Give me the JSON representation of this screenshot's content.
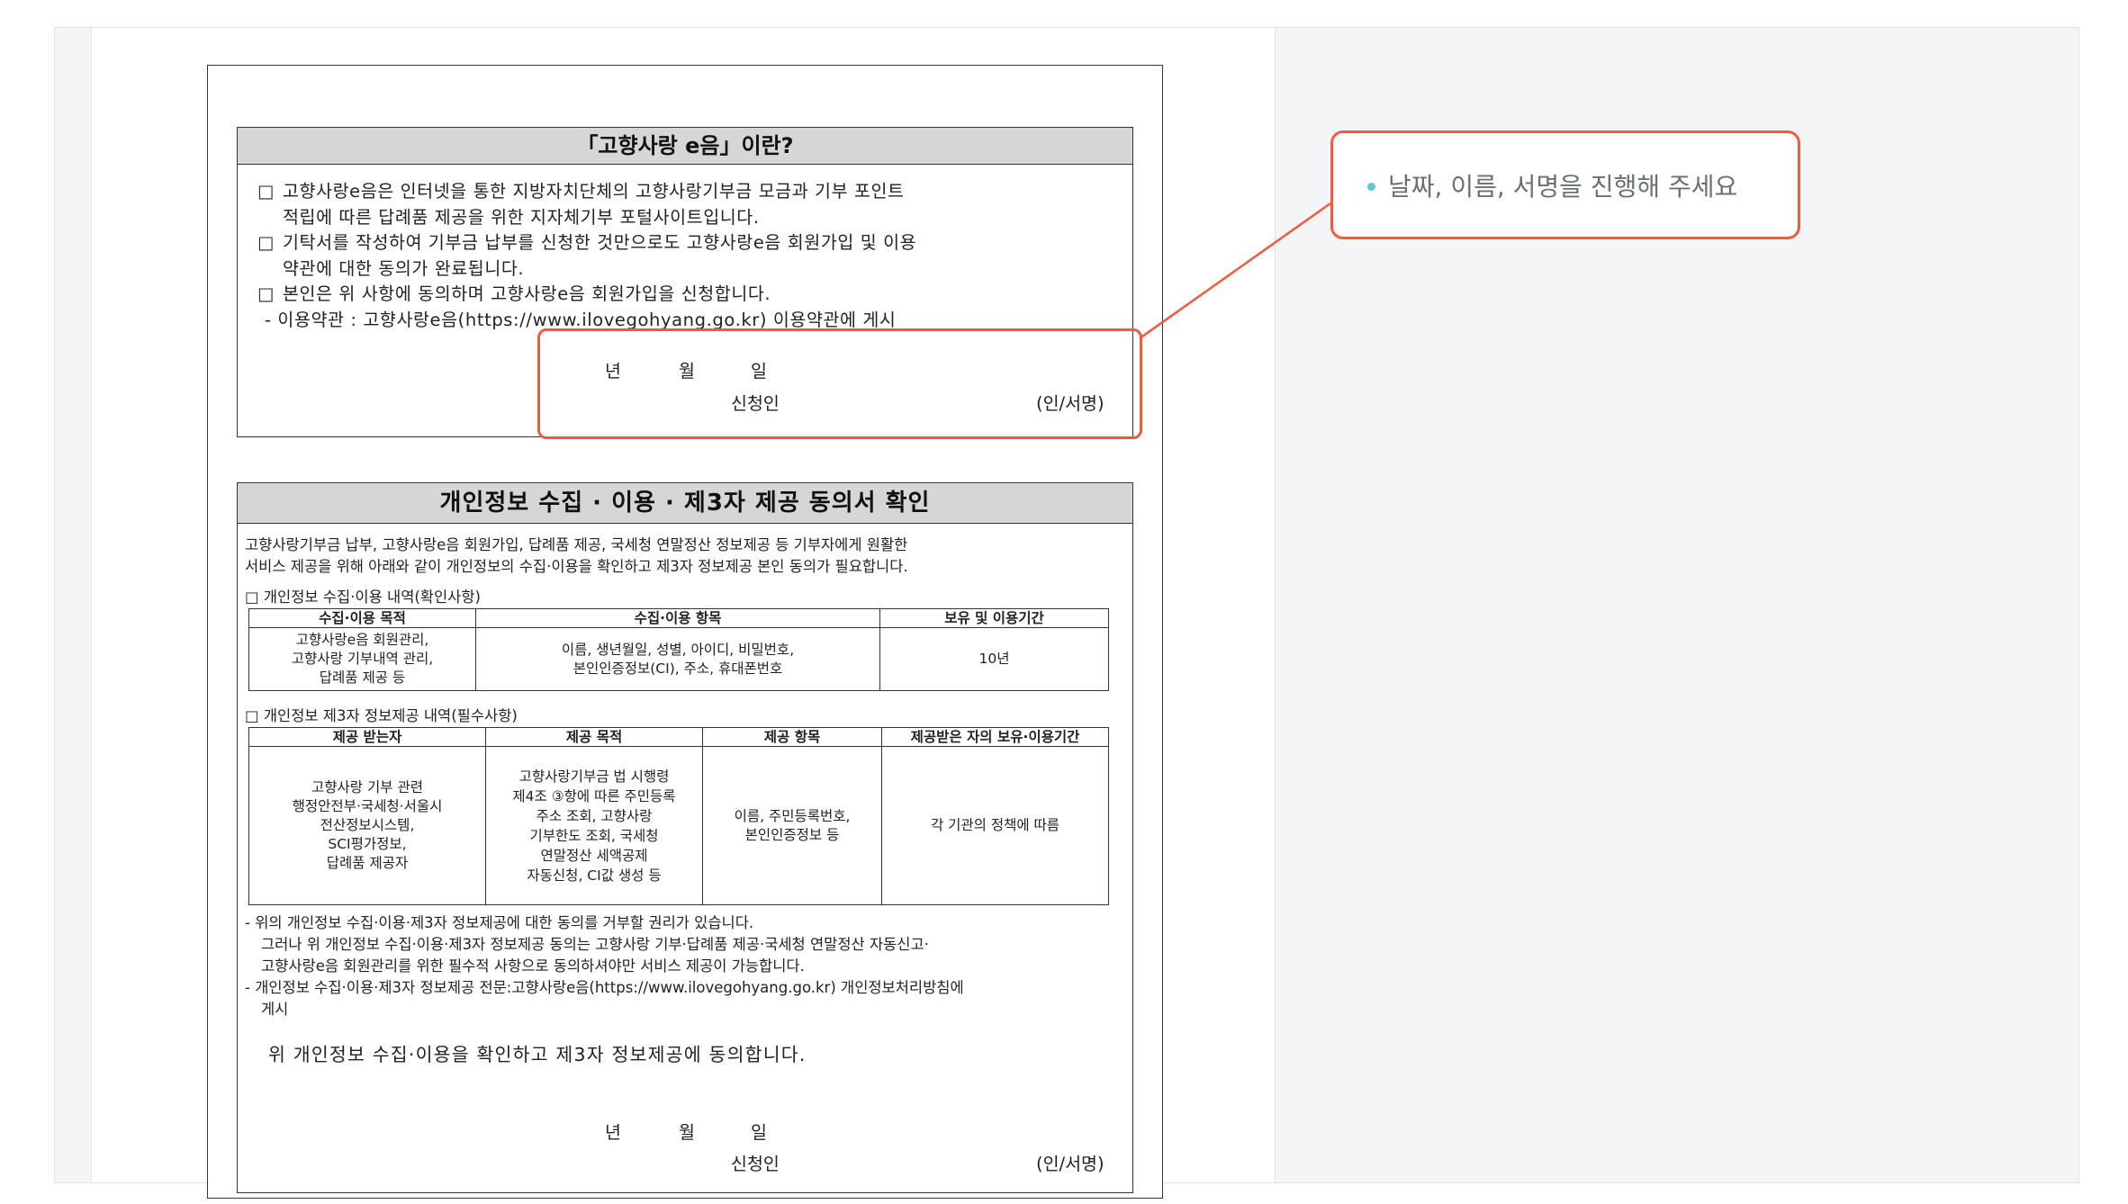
{
  "box1": {
    "title": "「고향사랑 e음」이란?",
    "item1_line1": "고향사랑e음은 인터넷을 통한 지방자치단체의 고향사랑기부금 모금과 기부 포인트",
    "item1_line2": "적립에 따른 답례품 제공을 위한 지자체기부 포털사이트입니다.",
    "item2_line1": "기탁서를 작성하여 기부금 납부를 신청한 것만으로도 고향사랑e음 회원가입 및 이용",
    "item2_line2": "약관에 대한 동의가 완료됩니다.",
    "item3_line1": "본인은 위 사항에 동의하며 고향사랑e음 회원가입을 신청합니다.",
    "note": "- 이용약관 : 고향사랑e음(https://www.ilovegohyang.go.kr) 이용약관에 게시",
    "year": "년",
    "month": "월",
    "day": "일",
    "applicant": "신청인",
    "sign": "(인/서명)",
    "checkbox": "□"
  },
  "box2": {
    "title": "개인정보 수집 · 이용 · 제3자 제공 동의서 확인",
    "intro_line1": "고향사랑기부금 납부, 고향사랑e음 회원가입, 답례품 제공, 국세청 연말정산 정보제공 등 기부자에게 원활한",
    "intro_line2": "서비스 제공을 위해 아래와 같이 개인정보의 수집·이용을 확인하고 제3자 정보제공 본인 동의가 필요합니다.",
    "section1": "□ 개인정보 수집·이용 내역(확인사항)",
    "table1": {
      "h1": "수집·이용 목적",
      "h2": "수집·이용 항목",
      "h3": "보유 및 이용기간",
      "c1_l1": "고향사랑e음 회원관리,",
      "c1_l2": "고향사랑 기부내역 관리,",
      "c1_l3": "답례품 제공 등",
      "c2_l1": "이름, 생년월일, 성별, 아이디, 비밀번호,",
      "c2_l2": "본인인증정보(CI), 주소, 휴대폰번호",
      "c3": "10년"
    },
    "section2": "□ 개인정보 제3자 정보제공 내역(필수사항)",
    "table2": {
      "h1": "제공 받는자",
      "h2": "제공 목적",
      "h3": "제공 항목",
      "h4": "제공받은 자의 보유·이용기간",
      "c1_l1": "고향사랑 기부 관련",
      "c1_l2": "행정안전부·국세청·서울시",
      "c1_l3": "전산정보시스템,",
      "c1_l4": "SCI평가정보,",
      "c1_l5": "답례품 제공자",
      "c2_l1": "고향사랑기부금 법 시행령",
      "c2_l2": "제4조 ③항에 따른 주민등록",
      "c2_l3": "주소 조회, 고향사랑",
      "c2_l4": "기부한도 조회, 국세청",
      "c2_l5": "연말정산 세액공제",
      "c2_l6": "자동신청, CI값 생성 등",
      "c3_l1": "이름, 주민등록번호,",
      "c3_l2": "본인인증정보 등",
      "c4": "각 기관의 정책에 따름"
    },
    "fn1": "- 위의 개인정보 수집·이용·제3자 정보제공에 대한 동의를 거부할 권리가 있습니다.",
    "fn2": "그러나 위 개인정보 수집·이용·제3자 정보제공 동의는 고향사랑 기부·답례품 제공·국세청 연말정산 자동신고·",
    "fn3": "고향사랑e음 회원관리를 위한 필수적 사항으로 동의하셔야만 서비스 제공이 가능합니다.",
    "fn4": "- 개인정보 수집·이용·제3자 정보제공 전문:고향사랑e음(https://www.ilovegohyang.go.kr) 개인정보처리방침에",
    "fn5": "게시",
    "confirm": "위 개인정보 수집·이용을 확인하고 제3자 정보제공에 동의합니다.",
    "year": "년",
    "month": "월",
    "day": "일",
    "applicant": "신청인",
    "sign": "(인/서명)"
  },
  "callout": {
    "text": "날짜, 이름, 서명을 진행해 주세요",
    "icon": "pencil-dot-icon"
  },
  "colors": {
    "accent": "#f35a3c",
    "icon": "#5bc8d6",
    "header_gray": "#d6d6d6"
  }
}
